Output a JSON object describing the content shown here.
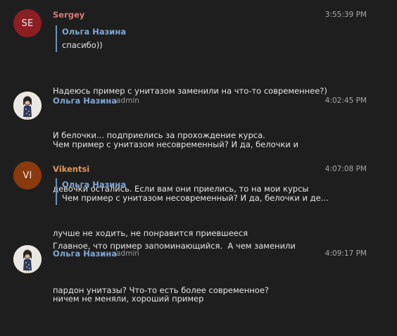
{
  "messages": [
    {
      "avatar_text": "SE",
      "avatar_color": "#8b1f22",
      "author": "Sergey",
      "author_color": "#d97b75",
      "role": "",
      "time": "3:55:39 PM",
      "quote": {
        "author": "Ольга Назина",
        "text": "спасибо))"
      },
      "lines": [
        "Надеюсь пример с унитазом заменили на что-то современнее?)",
        "И белочки... подприелись за прохождение курса."
      ]
    },
    {
      "avatar_text": "",
      "avatar_color": "#e9e6e3",
      "author": "Ольга Назина",
      "author_color": "#7fa7d6",
      "role": "admin",
      "time": "4:02:45 PM",
      "quote": null,
      "lines": [
        "Чем пример с унитазом несовременный? И да, белочки и",
        "девочки остались. Если вам они приелись, то на мои курсы",
        "лучше не ходить, не понравится приевшееся"
      ]
    },
    {
      "avatar_text": "VI",
      "avatar_color": "#8a3a0c",
      "author": "Vikentsi",
      "author_color": "#e0955f",
      "role": "",
      "time": "4:07:08 PM",
      "quote": {
        "author": "Ольга Назина",
        "text": "Чем пример с унитазом несовременный? И да, белочки и де..."
      },
      "lines": [
        "Главное, что пример запоминающийся.  А чем заменили",
        "пардон унитазы? Что-то есть более современное?"
      ]
    },
    {
      "avatar_text": "",
      "avatar_color": "#e9e6e3",
      "author": "Ольга Назина",
      "author_color": "#7fa7d6",
      "role": "admin",
      "time": "4:09:17 PM",
      "quote": null,
      "lines": [
        "ничем не меняли, хороший пример"
      ]
    }
  ]
}
